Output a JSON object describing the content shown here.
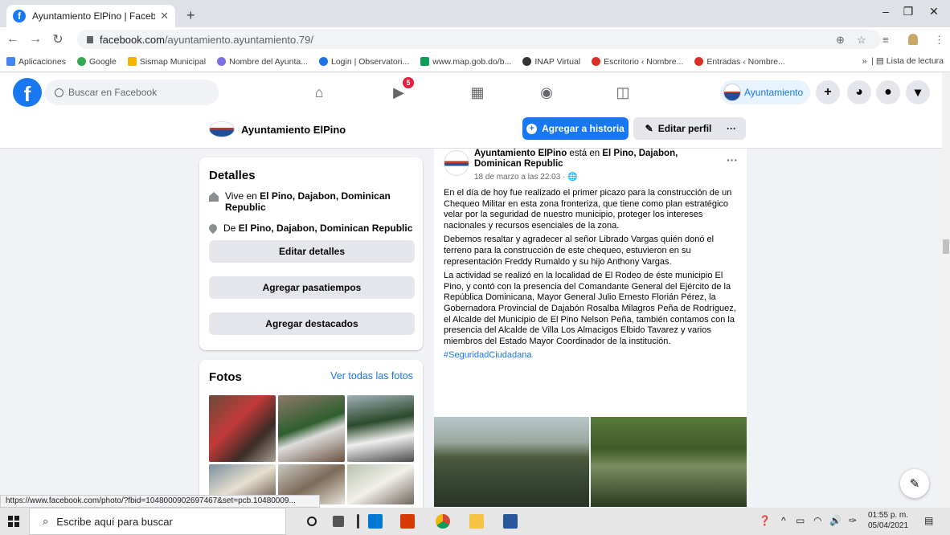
{
  "browser": {
    "tab_title": "Ayuntamiento ElPino | Facebook",
    "url_host": "facebook.com",
    "url_path": "/ayuntamiento.ayuntamiento.79/",
    "bookmarks": [
      {
        "label": "Aplicaciones",
        "color": "#4285f4"
      },
      {
        "label": "Google",
        "color": "#34a853"
      },
      {
        "label": "Sismap Municipal",
        "color": "#f4b400"
      },
      {
        "label": "Nombre del Ayunta...",
        "color": "#7b6ee6"
      },
      {
        "label": "Login | Observatori...",
        "color": "#1a73e8"
      },
      {
        "label": "www.map.gob.do/b...",
        "color": "#0f9d58"
      },
      {
        "label": "INAP Virtual",
        "color": "#333333"
      },
      {
        "label": "Escritorio ‹ Nombre...",
        "color": "#d93025"
      },
      {
        "label": "Entradas ‹ Nombre...",
        "color": "#d93025"
      }
    ],
    "reading_list": "Lista de lectura",
    "status_url": "https://www.facebook.com/photo/?fbid=1048000902697467&set=pcb.10480009..."
  },
  "facebook": {
    "search_placeholder": "Buscar en Facebook",
    "notif_count": "5",
    "profile_chip": "Ayuntamiento",
    "page_name": "Ayuntamiento ElPino",
    "add_story": "Agregar a historia",
    "edit_profile": "Editar perfil",
    "more": "···"
  },
  "details": {
    "title": "Detalles",
    "lives_prefix": "Vive en ",
    "lives_place": "El Pino, Dajabon, Dominican Republic",
    "from_prefix": "De ",
    "from_place": "El Pino, Dajabon, Dominican Republic",
    "edit_details": "Editar detalles",
    "add_hobbies": "Agregar pasatiempos",
    "add_featured": "Agregar destacados"
  },
  "photos": {
    "title": "Fotos",
    "see_all": "Ver todas las fotos"
  },
  "post": {
    "author": "Ayuntamiento ElPino",
    "is_at": " está en ",
    "location": "El Pino, Dajabon, Dominican Republic",
    "date": "18 de marzo a las 22:03 · ",
    "p1": "En el día de hoy fue realizado el primer picazo para la construcción de un Chequeo Militar en esta zona fronteriza, que tiene como plan estratégico velar por la seguridad de nuestro municipio, proteger los intereses nacionales y recursos esenciales de la zona.",
    "p2": " Debemos resaltar y agradecer al señor Librado Vargas quién donó el terreno  para la construcción de este chequeo,   estuvieron  en su representación Freddy Rumaldo y su hijo Anthony Vargas.",
    "p3": "La actividad se realizó en la localidad de El Rodeo de éste municipio El Pino, y contó con la presencia del Comandante General del Ejército de la República Dominicana, Mayor General Julio Ernesto Florián Pérez, la Gobernadora Provincial de Dajabón Rosalba Milagros Peña de Rodríguez, el Alcalde del Municipio de El Pino Nelson Peña, también contamos con la presencia del Alcalde de Villa Los Almacigos Elbido Tavarez y varios miembros del Estado Mayor Coordinador de la institución.",
    "hashtag": "#SeguridadCiudadana"
  },
  "taskbar": {
    "search_placeholder": "Escribe aquí para buscar",
    "time": "01:55 p. m.",
    "date": "05/04/2021"
  }
}
